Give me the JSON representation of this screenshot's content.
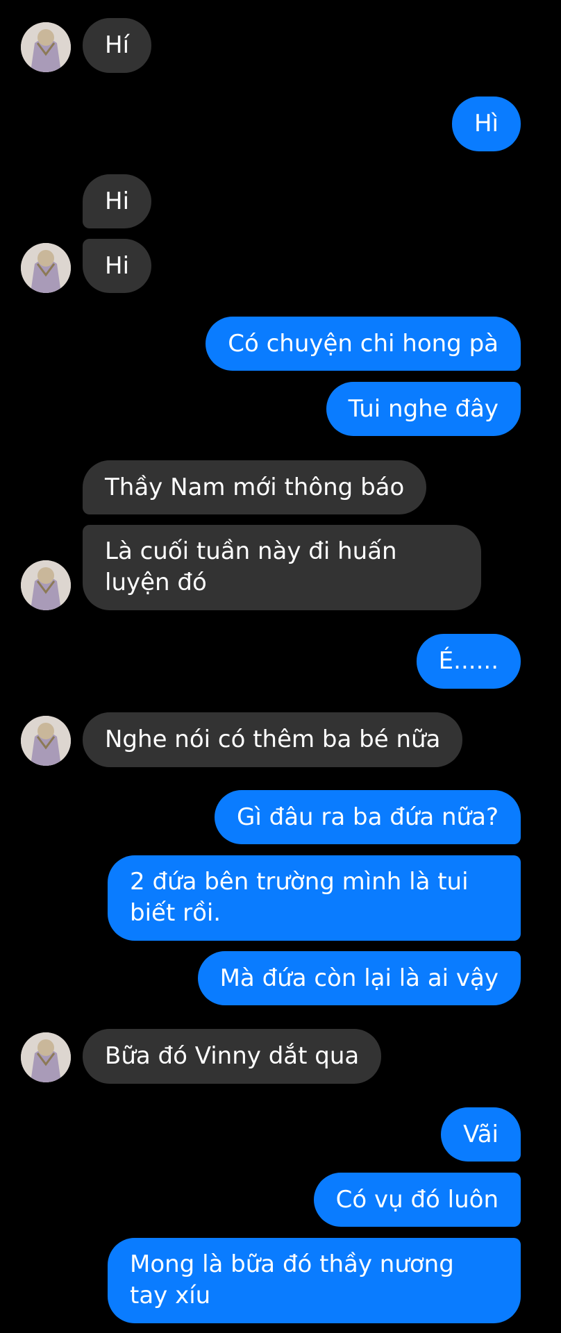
{
  "chat": {
    "avatar_icon": "contact-avatar",
    "colors": {
      "incoming": "#333333",
      "outgoing": "#0a7cff",
      "background": "#000000"
    },
    "messages": [
      {
        "from": "them",
        "text": "Hí"
      },
      {
        "from": "me",
        "text": "Hì"
      },
      {
        "from": "them",
        "text": "Hi"
      },
      {
        "from": "them",
        "text": "Hi"
      },
      {
        "from": "me",
        "text": "Có chuyện chi hong pà"
      },
      {
        "from": "me",
        "text": "Tui nghe đây"
      },
      {
        "from": "them",
        "text": "Thầy Nam mới thông báo"
      },
      {
        "from": "them",
        "text": "Là cuối tuần này đi huấn luyện đó"
      },
      {
        "from": "me",
        "text": "É......"
      },
      {
        "from": "them",
        "text": "Nghe nói có thêm ba bé nữa"
      },
      {
        "from": "me",
        "text": "Gì đâu ra ba đứa nữa?"
      },
      {
        "from": "me",
        "text": "2 đứa bên trường mình là tui biết rồi."
      },
      {
        "from": "me",
        "text": "Mà đứa còn lại là ai vậy"
      },
      {
        "from": "them",
        "text": "Bữa đó Vinny dắt qua"
      },
      {
        "from": "me",
        "text": "Vãi"
      },
      {
        "from": "me",
        "text": "Có vụ đó luôn"
      },
      {
        "from": "me",
        "text": "Mong là bữa đó thầy nương tay xíu"
      }
    ]
  }
}
